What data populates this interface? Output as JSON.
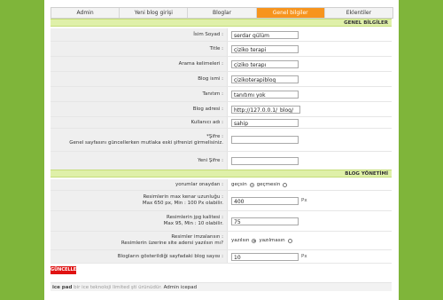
{
  "tabs": [
    {
      "label": "Admin"
    },
    {
      "label": "Yeni blog girişi"
    },
    {
      "label": "Bloglar"
    },
    {
      "label": "Genel bilgiler"
    },
    {
      "label": "Eklentiler"
    }
  ],
  "sections": {
    "general": "GENEL BİLGİLER",
    "blog": "BLOG YÖNETİMİ"
  },
  "general_fields": {
    "name": {
      "label": "İsim Soyad :",
      "value": "serdar gülüm"
    },
    "title": {
      "label": "Title :",
      "value": "çiziko terapi"
    },
    "keywords": {
      "label": "Arama kelimeleri :",
      "value": "çiziko terapı"
    },
    "blogname": {
      "label": "Blog ismi :",
      "value": "çizikoterapiblog"
    },
    "desc": {
      "label": "Tanıtım :",
      "value": "tanıtımı yok"
    },
    "address": {
      "label": "Blog adresi :",
      "value": "http://127.0.0.1/_blog/"
    },
    "username": {
      "label": "Kullanıcı adı :",
      "value": "sahip"
    },
    "password": {
      "label_line1": "*Şifre :",
      "label_line2": "Genel sayfasını güncellerken mutlaka eski şifrenizi girmelisiniz.",
      "value": ""
    },
    "newpass": {
      "label": "Yeni Şifre :",
      "value": ""
    }
  },
  "blog_fields": {
    "comments": {
      "label": "yorumlar onaydan :",
      "opt1": "geçsin",
      "opt2": "geçmesin"
    },
    "maxsize": {
      "label_line1": "Resimlerin max kenar uzunluğu :",
      "label_line2": "Max 650 px, Min : 100 Px olabilir.",
      "value": "400",
      "unit": "Px"
    },
    "quality": {
      "label_line1": "Resimlerin jpg kalitesi :",
      "label_line2": "Max 95, Min : 10 olabilir.",
      "value": "75"
    },
    "sign": {
      "label_line1": "Resimler imzalansın :",
      "label_line2": "Resimlerin üzerine site adersi yazılsın mı?",
      "opt1": "yazılsın",
      "opt2": "yazılmasın"
    },
    "perpage": {
      "label": "Blogların gösterildiği sayfadaki blog sayısı :",
      "value": "10",
      "unit": "Px"
    }
  },
  "save_label": "GÜNCELLE",
  "footer": {
    "brand": "ice pad",
    "mid": " bir ice teknoloji limited şti ürünüdür. ",
    "admin": "Admin icepad"
  }
}
